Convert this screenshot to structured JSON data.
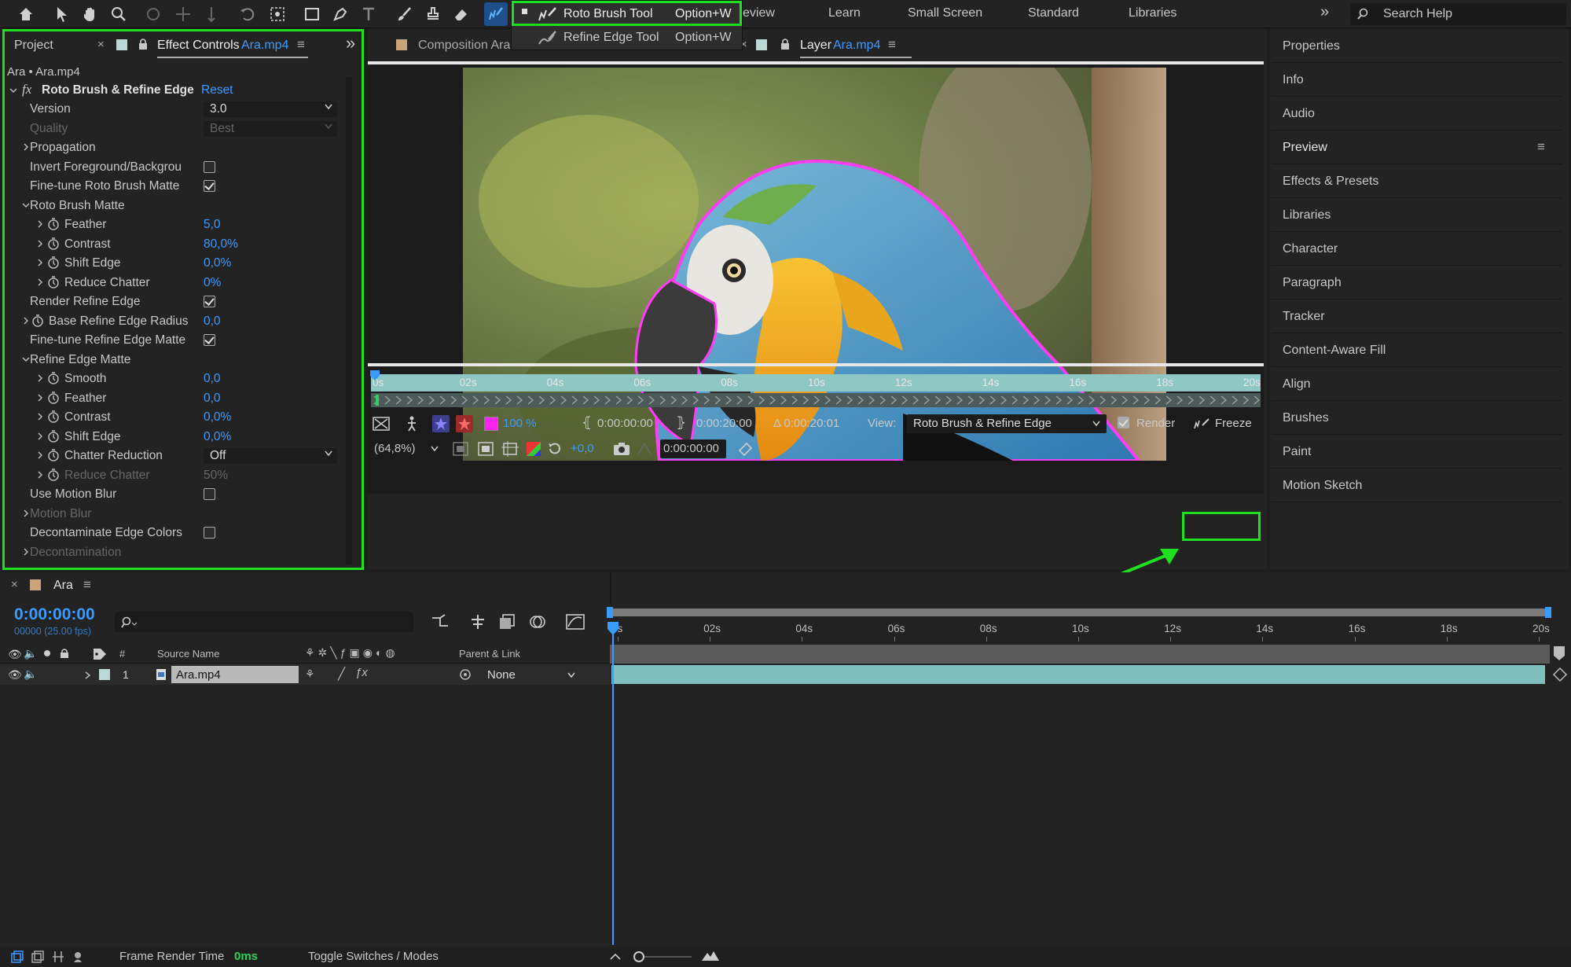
{
  "toolbar": {
    "workspaces": [
      "eview",
      "Learn",
      "Small Screen",
      "Standard",
      "Libraries"
    ],
    "search_placeholder": "Search Help"
  },
  "tool_menu": {
    "items": [
      {
        "label": "Roto Brush Tool",
        "shortcut": "Option+W"
      },
      {
        "label": "Refine Edge Tool",
        "shortcut": "Option+W"
      }
    ]
  },
  "left_panel": {
    "tab_project": "Project",
    "tab_effect_controls": "Effect Controls",
    "tab_effect_controls_file": "Ara.mp4",
    "breadcrumb": "Ara • Ara.mp4",
    "effect_name": "Roto Brush & Refine Edge",
    "reset_label": "Reset",
    "rows": [
      {
        "label": "Version",
        "value": "3.0",
        "kind": "select"
      },
      {
        "label": "Quality",
        "value": "Best",
        "kind": "select",
        "dim": true
      },
      {
        "label": "Propagation",
        "kind": "group"
      },
      {
        "label": "Invert Foreground/Backgrou",
        "kind": "check",
        "checked": false
      },
      {
        "label": "Fine-tune Roto Brush Matte",
        "kind": "check",
        "checked": true
      },
      {
        "label": "Roto Brush Matte",
        "kind": "section"
      },
      {
        "label": "Feather",
        "value": "5,0",
        "kind": "prop"
      },
      {
        "label": "Contrast",
        "value": "80,0%",
        "kind": "prop"
      },
      {
        "label": "Shift Edge",
        "value": "0,0%",
        "kind": "prop"
      },
      {
        "label": "Reduce Chatter",
        "value": "0%",
        "kind": "prop"
      },
      {
        "label": "Render Refine Edge",
        "kind": "check",
        "checked": true
      },
      {
        "label": "Base Refine Edge Radius",
        "value": "0,0",
        "kind": "prop-top"
      },
      {
        "label": "Fine-tune Refine Edge Matte",
        "kind": "check",
        "checked": true
      },
      {
        "label": "Refine Edge Matte",
        "kind": "section"
      },
      {
        "label": "Smooth",
        "value": "0,0",
        "kind": "prop"
      },
      {
        "label": "Feather",
        "value": "0,0",
        "kind": "prop"
      },
      {
        "label": "Contrast",
        "value": "0,0%",
        "kind": "prop"
      },
      {
        "label": "Shift Edge",
        "value": "0,0%",
        "kind": "prop"
      },
      {
        "label": "Chatter Reduction",
        "value": "Off",
        "kind": "prop-select"
      },
      {
        "label": "Reduce Chatter",
        "value": "50%",
        "kind": "prop",
        "dim": true
      },
      {
        "label": "Use Motion Blur",
        "kind": "check",
        "checked": false
      },
      {
        "label": "Motion Blur",
        "kind": "group",
        "dim": true
      },
      {
        "label": "Decontaminate Edge Colors",
        "kind": "check",
        "checked": false
      },
      {
        "label": "Decontamination",
        "kind": "group",
        "dim": true
      }
    ]
  },
  "viewer": {
    "tab_composition": "Composition Ara",
    "tab_layer": "Layer",
    "tab_layer_file": "Ara.mp4",
    "ruler_ticks": [
      "0s",
      "02s",
      "04s",
      "06s",
      "08s",
      "10s",
      "12s",
      "14s",
      "16s",
      "18s",
      "20s"
    ],
    "zoom_percent": "100 %",
    "in_point": "0:00:00:00",
    "out_point": "0:00:20:00",
    "duration": "Δ 0:00:20:01",
    "view_label": "View:",
    "view_value": "Roto Brush & Refine Edge",
    "render_label": "Render",
    "freeze_label": "Freeze",
    "magnification": "(64,8%)",
    "exposure": "+0,0",
    "current_time": "0:00:00:00"
  },
  "right_panel": {
    "items": [
      "Properties",
      "Info",
      "Audio",
      "Preview",
      "Effects & Presets",
      "Libraries",
      "Character",
      "Paragraph",
      "Tracker",
      "Content-Aware Fill",
      "Align",
      "Brushes",
      "Paint",
      "Motion Sketch"
    ]
  },
  "timeline": {
    "comp_name": "Ara",
    "timecode": "0:00:00:00",
    "frame_info": "00000 (25.00 fps)",
    "col_number": "#",
    "col_source": "Source Name",
    "col_parent": "Parent & Link",
    "layer_number": "1",
    "layer_name": "Ara.mp4",
    "parent_value": "None",
    "ruler_ticks": [
      "0s",
      "02s",
      "04s",
      "06s",
      "08s",
      "10s",
      "12s",
      "14s",
      "16s",
      "18s",
      "20s"
    ]
  },
  "statusbar": {
    "frame_render_label": "Frame Render Time",
    "frame_render_value": "0ms",
    "toggle_label": "Toggle Switches / Modes"
  },
  "colors": {
    "accent": "#3a9bff",
    "highlight": "#1fe01f",
    "timebar": "#7fbfbd"
  }
}
